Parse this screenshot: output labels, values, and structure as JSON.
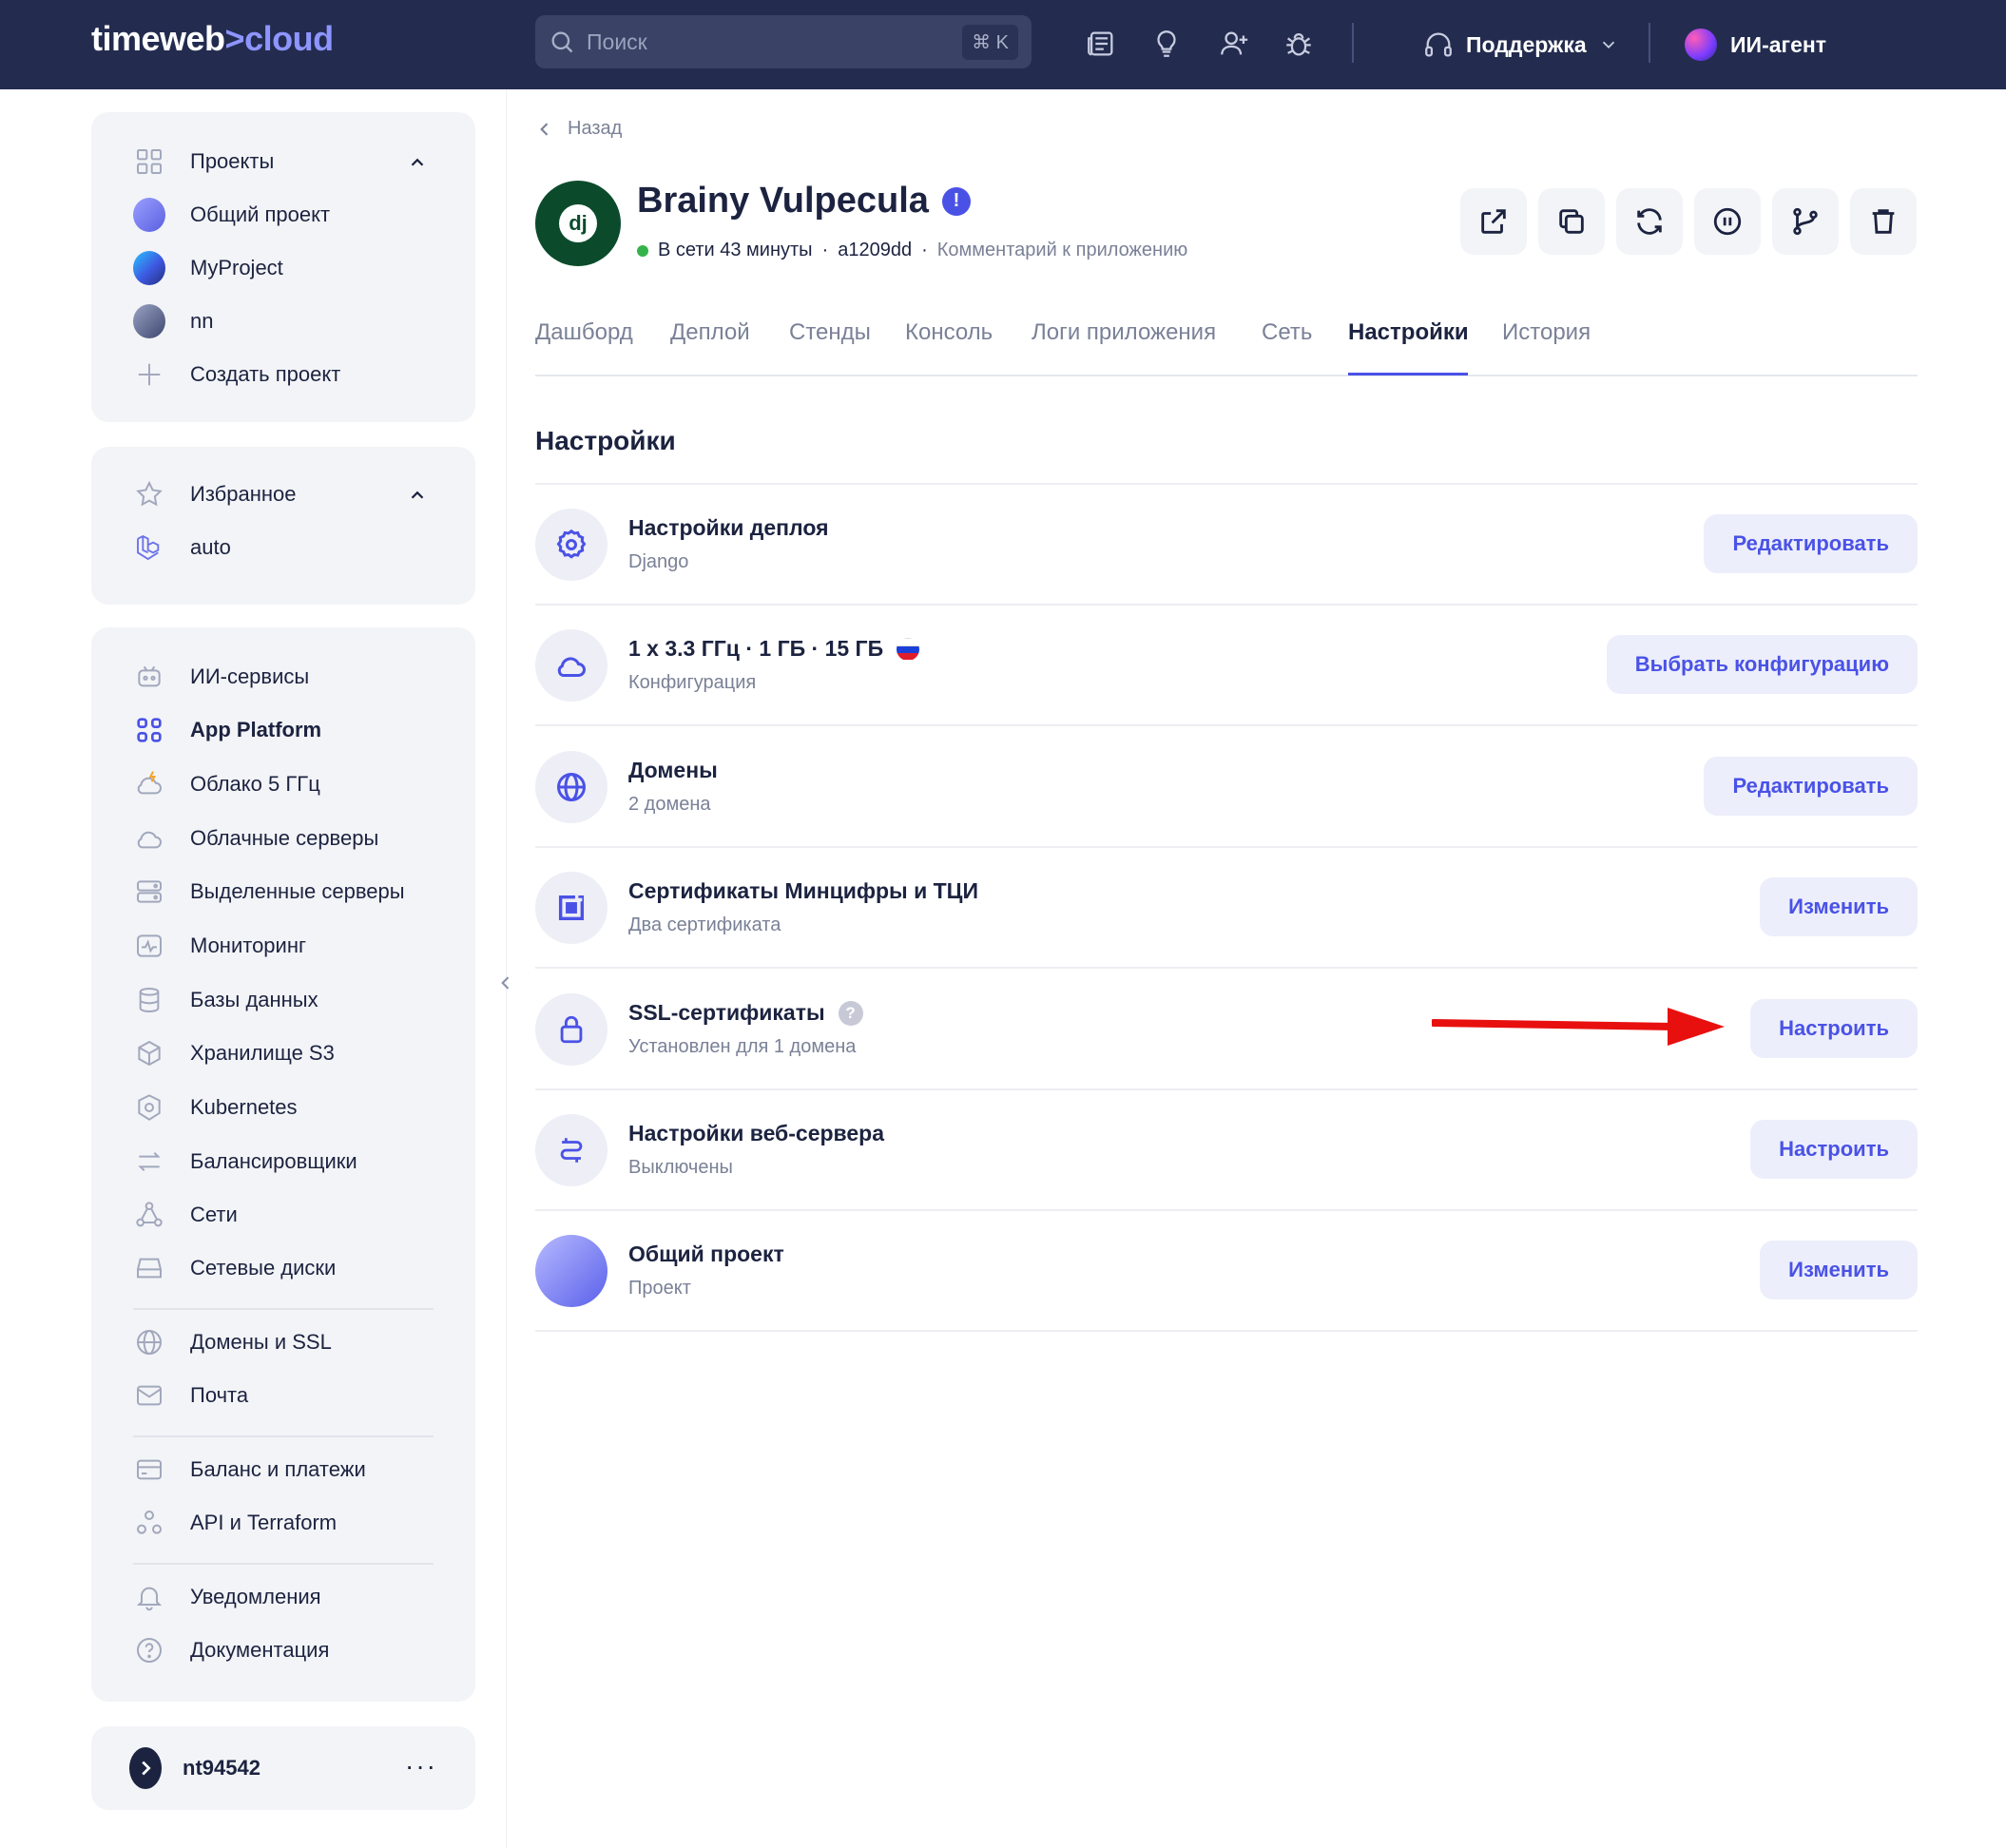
{
  "header": {
    "logo_main": "timeweb",
    "logo_sep": ">",
    "logo_cloud": "cloud",
    "search_placeholder": "Поиск",
    "search_shortcut": "⌘ K",
    "icons": [
      "news-icon",
      "lightbulb-icon",
      "add-user-icon",
      "bug-icon"
    ],
    "support_label": "Поддержка",
    "agent_label": "ИИ-агент"
  },
  "sidebar": {
    "projects_label": "Проекты",
    "projects": [
      {
        "label": "Общий проект",
        "color": "#6f74f0"
      },
      {
        "label": "MyProject",
        "color": "#3e6fe0"
      },
      {
        "label": "nn",
        "color": "#6c7391"
      }
    ],
    "create_project_label": "Создать проект",
    "favorites_label": "Избранное",
    "favorites": [
      {
        "label": "auto"
      }
    ],
    "services": [
      {
        "label": "ИИ-сервисы",
        "icon": "robot-icon"
      },
      {
        "label": "App Platform",
        "icon": "apps-grid-icon",
        "active": true
      },
      {
        "label": "Облако 5 ГГц",
        "icon": "lightning-cloud-icon"
      },
      {
        "label": "Облачные серверы",
        "icon": "cloud-icon"
      },
      {
        "label": "Выделенные серверы",
        "icon": "server-icon"
      },
      {
        "label": "Мониторинг",
        "icon": "monitoring-icon"
      },
      {
        "label": "Базы данных",
        "icon": "database-icon"
      },
      {
        "label": "Хранилище S3",
        "icon": "storage-icon"
      },
      {
        "label": "Kubernetes",
        "icon": "kubernetes-icon"
      },
      {
        "label": "Балансировщики",
        "icon": "balancer-icon"
      },
      {
        "label": "Сети",
        "icon": "network-icon"
      },
      {
        "label": "Сетевые диски",
        "icon": "disk-icon"
      }
    ],
    "extras": [
      {
        "label": "Домены и SSL",
        "icon": "globe-icon"
      },
      {
        "label": "Почта",
        "icon": "mail-icon"
      }
    ],
    "billing": [
      {
        "label": "Баланс и платежи",
        "icon": "card-icon"
      },
      {
        "label": "API и Terraform",
        "icon": "api-icon"
      }
    ],
    "help": [
      {
        "label": "Уведомления",
        "icon": "bell-icon"
      },
      {
        "label": "Документация",
        "icon": "question-icon"
      }
    ],
    "account_label": "nt94542",
    "account_menu": "···"
  },
  "main": {
    "back_label": "Назад",
    "app": {
      "avatar_text": "dj",
      "title": "Brainy Vulpecula",
      "warning_mark": "!",
      "status": "В сети 43 минуты",
      "commit": "a1209dd",
      "comment": "Комментарий к приложению",
      "sep": "·"
    },
    "tabs": [
      "Дашборд",
      "Деплой",
      "Стенды",
      "Консоль",
      "Логи приложения",
      "Сеть",
      "Настройки",
      "История"
    ],
    "active_tab": "Настройки",
    "section_title": "Настройки",
    "rows": [
      {
        "title": "Настройки деплоя",
        "subtitle": "Django",
        "button": "Редактировать",
        "icon": "gear-icon"
      },
      {
        "title": "1 x 3.3 ГГц · 1 ГБ · 15 ГБ",
        "subtitle": "Конфигурация",
        "button": "Выбрать конфигурацию",
        "icon": "cloud-icon"
      },
      {
        "title": "Домены",
        "subtitle": "2 домена",
        "button": "Редактировать",
        "icon": "globe-icon"
      },
      {
        "title": "Сертификаты Минцифры и ТЦИ",
        "subtitle": "Два сертификата",
        "button": "Изменить",
        "icon": "certificate-icon"
      },
      {
        "title": "SSL-сертификаты",
        "subtitle": "Установлен для 1 домена",
        "button": "Настроить",
        "icon": "lock-icon",
        "help": "?"
      },
      {
        "title": "Настройки веб-сервера",
        "subtitle": "Выключены",
        "button": "Настроить",
        "icon": "webserver-icon"
      },
      {
        "title": "Общий проект",
        "subtitle": "Проект",
        "button": "Изменить",
        "icon": "project-icon"
      }
    ]
  },
  "colors": {
    "header_bg": "#232c4f",
    "accent": "#4a52e6",
    "button_bg": "#eceefb",
    "online": "#36b24a",
    "annotation_arrow": "#e8100f"
  }
}
